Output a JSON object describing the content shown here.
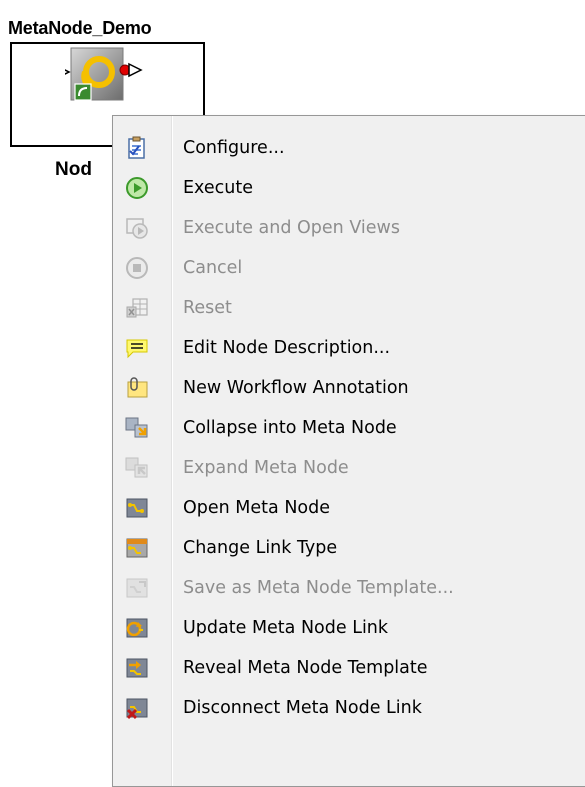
{
  "node": {
    "title": "MetaNode_Demo",
    "label": "Nod"
  },
  "context_menu": {
    "items": [
      {
        "label": "Configure...",
        "icon": "configure-icon",
        "enabled": true
      },
      {
        "label": "Execute",
        "icon": "execute-icon",
        "enabled": true
      },
      {
        "label": "Execute and Open Views",
        "icon": "execute-open-views-icon",
        "enabled": false
      },
      {
        "label": "Cancel",
        "icon": "cancel-icon",
        "enabled": false
      },
      {
        "label": "Reset",
        "icon": "reset-icon",
        "enabled": false
      },
      {
        "label": "Edit Node Description...",
        "icon": "edit-description-icon",
        "enabled": true
      },
      {
        "label": "New Workflow Annotation",
        "icon": "annotation-icon",
        "enabled": true
      },
      {
        "label": "Collapse into Meta Node",
        "icon": "collapse-metanode-icon",
        "enabled": true
      },
      {
        "label": "Expand Meta Node",
        "icon": "expand-metanode-icon",
        "enabled": false
      },
      {
        "label": "Open Meta Node",
        "icon": "open-metanode-icon",
        "enabled": true
      },
      {
        "label": "Change Link Type",
        "icon": "change-link-type-icon",
        "enabled": true
      },
      {
        "label": "Save as Meta Node Template...",
        "icon": "save-template-icon",
        "enabled": false
      },
      {
        "label": "Update Meta Node Link",
        "icon": "update-link-icon",
        "enabled": true
      },
      {
        "label": "Reveal Meta Node Template",
        "icon": "reveal-template-icon",
        "enabled": true
      },
      {
        "label": "Disconnect Meta Node Link",
        "icon": "disconnect-link-icon",
        "enabled": true
      }
    ]
  }
}
